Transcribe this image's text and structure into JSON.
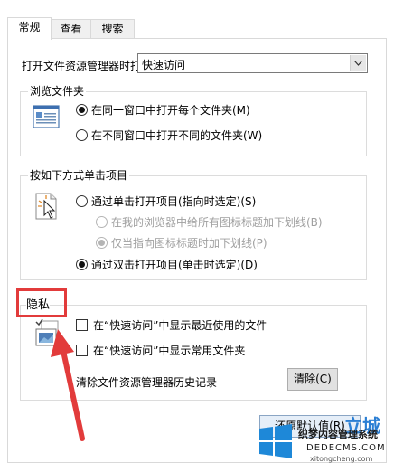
{
  "tabs": [
    {
      "label": "常规",
      "active": true
    },
    {
      "label": "查看",
      "active": false
    },
    {
      "label": "搜索",
      "active": false
    }
  ],
  "open_explorer": {
    "label": "打开文件资源管理器时打",
    "value": "快速访问"
  },
  "browse_folders": {
    "title": "浏览文件夹",
    "options": [
      {
        "label": "在同一窗口中打开每个文件夹(M)",
        "selected": true
      },
      {
        "label": "在不同窗口中打开不同的文件夹(W)",
        "selected": false
      }
    ]
  },
  "click_items": {
    "title": "按如下方式单击项目",
    "options": [
      {
        "label": "通过单击打开项目(指向时选定)(S)",
        "selected": false,
        "disabled": false
      },
      {
        "label": "在我的浏览器中给所有图标标题加下划线(B)",
        "selected": false,
        "disabled": true
      },
      {
        "label": "仅当指向图标标题时加下划线(P)",
        "selected": true,
        "disabled": true
      },
      {
        "label": "通过双击打开项目(单击时选定)(D)",
        "selected": true,
        "disabled": false
      }
    ]
  },
  "privacy": {
    "title": "隐私",
    "options": [
      {
        "label": "在“快速访问”中显示最近使用的文件",
        "checked": false
      },
      {
        "label": "在“快速访问”中显示常用文件夹",
        "checked": false
      }
    ],
    "clear_history_label": "清除文件资源管理器历史记录",
    "clear_button": "清除(C)"
  },
  "restore_button": "还原默认值(R)",
  "watermark": {
    "brand": "立城",
    "line1": "织梦内容管理系统",
    "url": "DEDECMS.COM",
    "sub": "xitongcheng.com"
  },
  "colors": {
    "highlight": "#e23b3b",
    "arrow": "#e23b3b",
    "panel_border": "#d9d9d9",
    "windows_blue": "#1e88d8"
  }
}
